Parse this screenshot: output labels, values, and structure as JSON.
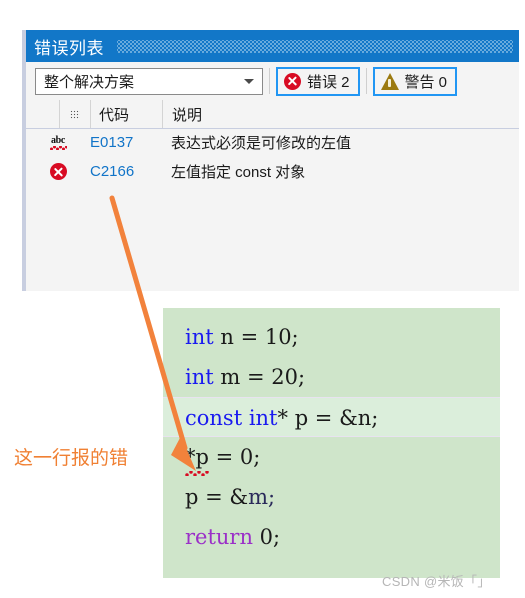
{
  "panel": {
    "title": "错误列表",
    "toolbar": {
      "scope_selected": "整个解决方案",
      "scope_icon": "chevron-down-icon",
      "error_button": {
        "icon": "error-circle-icon",
        "label": "错误 2",
        "border_color": "#2196f3",
        "icon_color": "#d80b23"
      },
      "warning_button": {
        "icon": "warning-triangle-icon",
        "label": "警告 0",
        "border_color": "#2196f3",
        "icon_color": "#9c7a10"
      }
    },
    "grid": {
      "headers": {
        "blank": "",
        "icon_col": "grid-dots-icon",
        "code": "代码",
        "description": "说明"
      },
      "rows": [
        {
          "icon": "abc-spellcheck-icon",
          "code": "E0137",
          "description": "表达式必须是可修改的左值"
        },
        {
          "icon": "error-circle-icon",
          "code": "C2166",
          "description": "左值指定 const 对象"
        }
      ]
    }
  },
  "annotation": {
    "label": "这一行报的错",
    "color": "#f08033",
    "arrow_icon": "arrow-pointer-icon"
  },
  "code_block": {
    "background": "#cfe5ca",
    "highlight_background": "#dbeedb",
    "lines": [
      {
        "tokens": [
          {
            "text": "int",
            "kind": "keyword"
          },
          {
            "text": " n = 10;",
            "kind": "plain"
          }
        ],
        "highlighted": false,
        "error": false
      },
      {
        "tokens": [
          {
            "text": "int",
            "kind": "keyword"
          },
          {
            "text": " m = 20;",
            "kind": "plain"
          }
        ],
        "highlighted": false,
        "error": false
      },
      {
        "tokens": [
          {
            "text": "const int",
            "kind": "keyword"
          },
          {
            "text": "* p = &n;",
            "kind": "plain"
          }
        ],
        "highlighted": true,
        "error": false
      },
      {
        "tokens": [
          {
            "text": "*p",
            "kind": "error-underlined"
          },
          {
            "text": " = 0;",
            "kind": "plain"
          }
        ],
        "highlighted": false,
        "error": true
      },
      {
        "tokens": [
          {
            "text": "p = &",
            "kind": "plain"
          },
          {
            "text": "m;",
            "kind": "ident"
          }
        ],
        "highlighted": false,
        "error": false
      },
      {
        "tokens": [
          {
            "text": "return",
            "kind": "keyword2"
          },
          {
            "text": " 0;",
            "kind": "plain"
          }
        ],
        "highlighted": false,
        "error": false
      }
    ],
    "line_1": "int n = 10;",
    "line_2": "int m = 20;",
    "line_3": "const int* p = &n;",
    "line_4": "*p = 0;",
    "line_5": "p = &m;",
    "line_6": "return 0;"
  },
  "watermark": "CSDN @米饭「」"
}
